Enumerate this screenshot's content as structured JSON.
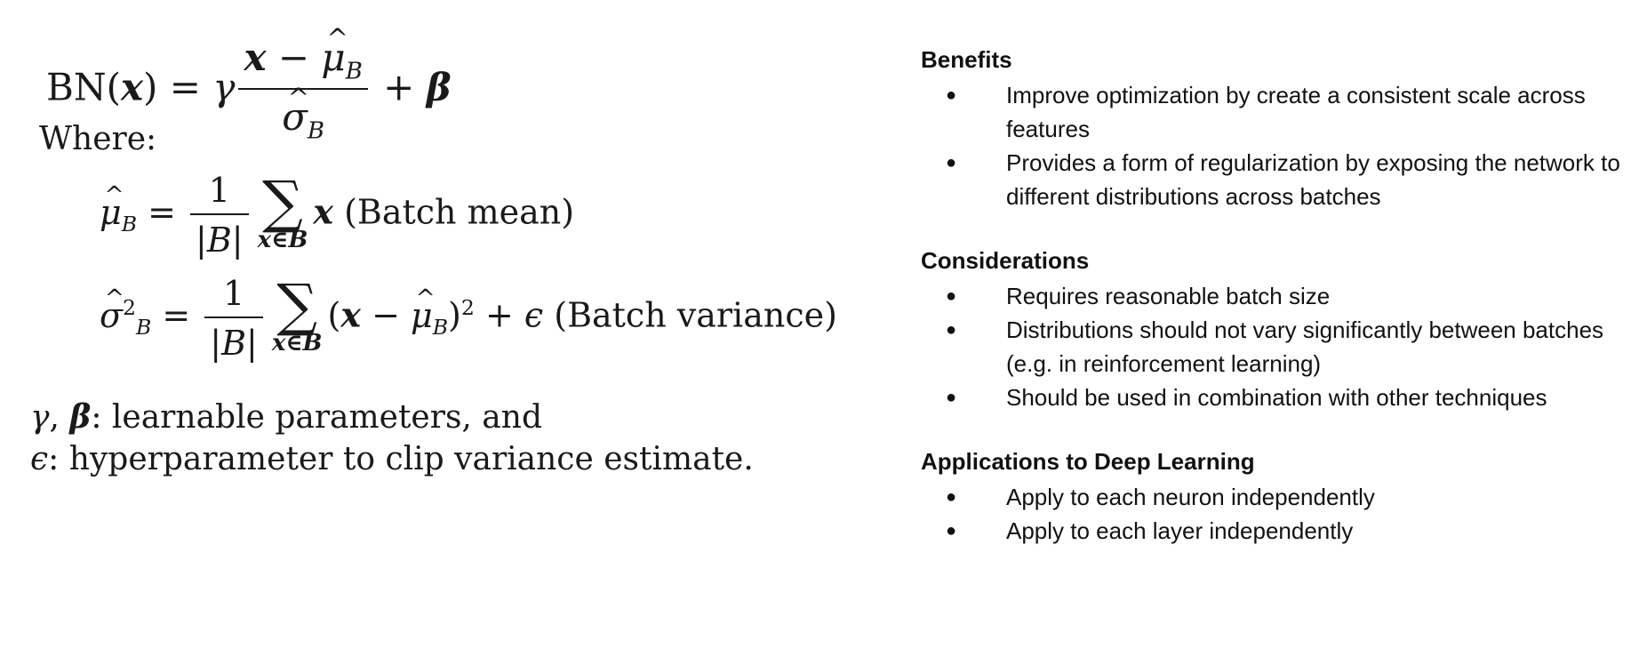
{
  "math": {
    "where_label": "Where:",
    "mean_label": "(Batch mean)",
    "variance_label": "(Batch variance)",
    "params_line": "learnable parameters, and",
    "epsilon_line": "hyperparameter to clip variance estimate."
  },
  "notes": {
    "benefits": {
      "title": "Benefits",
      "items": [
        "Improve optimization by create a consistent scale across features",
        "Provides a form of regularization by exposing the network to different distributions across batches"
      ]
    },
    "considerations": {
      "title": "Considerations",
      "items": [
        "Requires reasonable batch size",
        "Distributions should not vary significantly between batches (e.g. in reinforcement learning)",
        "Should be used in combination with other techniques"
      ]
    },
    "applications": {
      "title": "Applications to Deep Learning",
      "items": [
        "Apply to each neuron independently",
        "Apply to each layer independently"
      ]
    }
  }
}
